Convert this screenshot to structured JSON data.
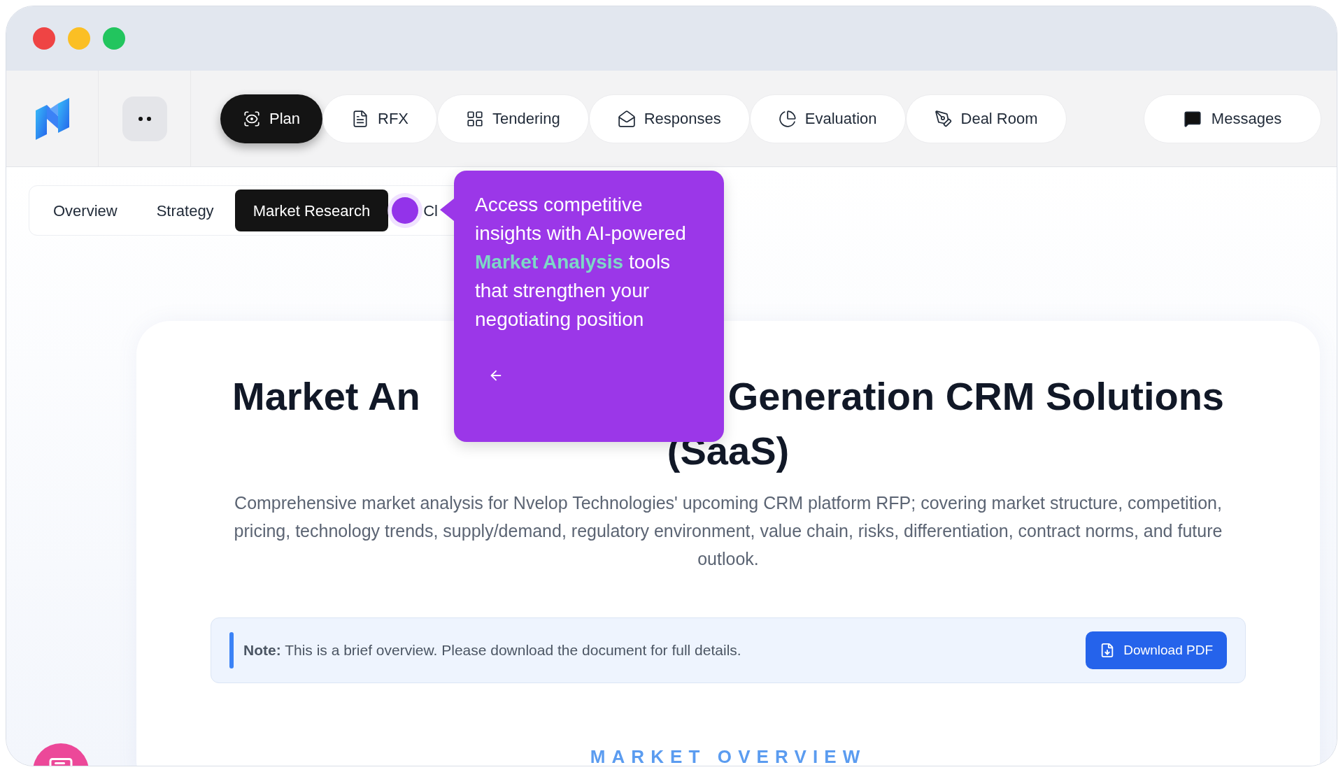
{
  "nav": {
    "tabs": [
      {
        "label": "Plan",
        "selected": true
      },
      {
        "label": "RFX",
        "selected": false
      },
      {
        "label": "Tendering",
        "selected": false
      },
      {
        "label": "Responses",
        "selected": false
      },
      {
        "label": "Evaluation",
        "selected": false
      },
      {
        "label": "Deal Room",
        "selected": false
      }
    ],
    "messages": {
      "label": "Messages"
    }
  },
  "subtabs": [
    {
      "label": "Overview",
      "selected": false
    },
    {
      "label": "Strategy",
      "selected": false
    },
    {
      "label": "Market Research",
      "selected": true
    },
    {
      "label": "Cl",
      "selected": false
    }
  ],
  "tooltip": {
    "text": "Access competitive insights with AI-powered **Market Analysis** tools that strengthen your negotiating position"
  },
  "report": {
    "title_parts": [
      "Market An",
      "Generation CRM Solutions",
      "(SaaS)"
    ],
    "description": "Comprehensive market analysis for Nvelop Technologies' upcoming CRM platform RFP; covering market structure, competition, pricing, technology trends, supply/demand, regulatory environment, value chain, risks, differentiation, contract norms, and future outlook.",
    "note": "**Note:** This is a brief overview. Please download the document for full details.",
    "download_button": "Download PDF",
    "section_heading": "MARKET OVERVIEW"
  }
}
